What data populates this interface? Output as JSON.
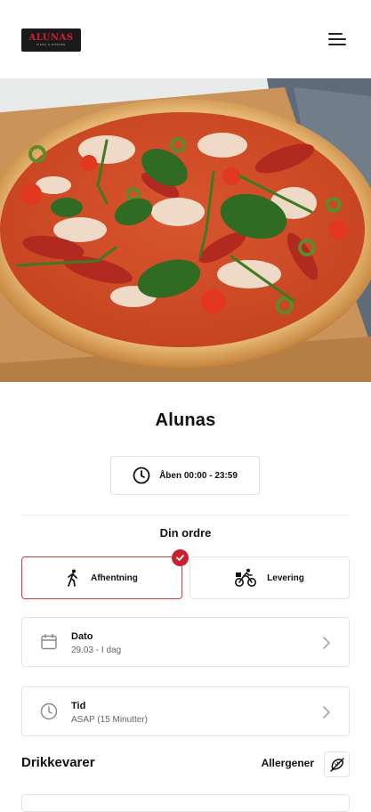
{
  "header": {
    "logo_text": "ALUNAS",
    "logo_subtext": "PIZZA & BURGER",
    "menu_icon": "hamburger-menu-icon"
  },
  "hero": {
    "image_alt": "Pizza med basilikum, tomat og chili"
  },
  "restaurant": {
    "name": "Alunas",
    "hours": "Åben 00:00 - 23:59",
    "hours_icon": "clock-icon"
  },
  "order": {
    "heading": "Din ordre",
    "options": [
      {
        "label": "Afhentning",
        "icon": "walking-person-icon",
        "selected": true
      },
      {
        "label": "Levering",
        "icon": "cyclist-icon",
        "selected": false
      }
    ]
  },
  "date_field": {
    "label": "Dato",
    "value": "29.03 - I dag",
    "icon": "calendar-icon"
  },
  "time_field": {
    "label": "Tid",
    "value": "ASAP (15 Minutter)",
    "icon": "clock-icon"
  },
  "menu_section": {
    "heading": "Drikkevarer",
    "allergen_label": "Allergener",
    "allergen_icon": "allergen-icon"
  },
  "colors": {
    "accent": "#c8202f",
    "border": "#e3e3e3"
  }
}
